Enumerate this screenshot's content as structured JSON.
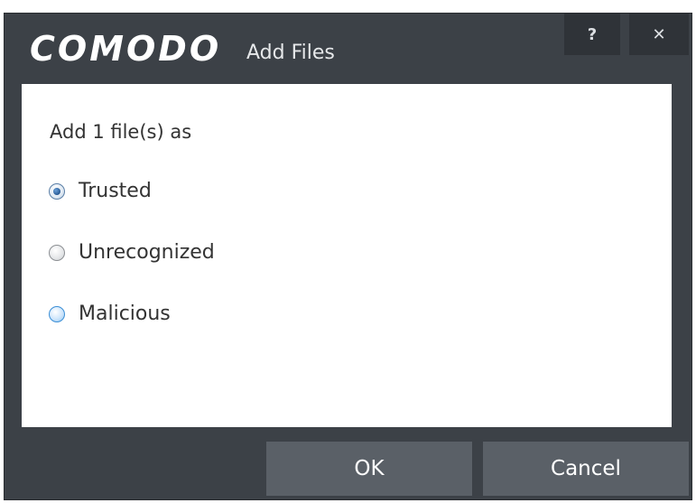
{
  "window": {
    "brand": "COMODO",
    "title": "Add Files",
    "help_label": "?",
    "close_label": "✕"
  },
  "dialog": {
    "prompt": "Add 1 file(s) as",
    "options": [
      {
        "label": "Trusted",
        "selected": true
      },
      {
        "label": "Unrecognized",
        "selected": false
      },
      {
        "label": "Malicious",
        "selected": false
      }
    ]
  },
  "buttons": {
    "ok": "OK",
    "cancel": "Cancel"
  },
  "colors": {
    "frame": "#3c4147",
    "button": "#5a6067",
    "content_bg": "#ffffff",
    "text": "#333333"
  }
}
